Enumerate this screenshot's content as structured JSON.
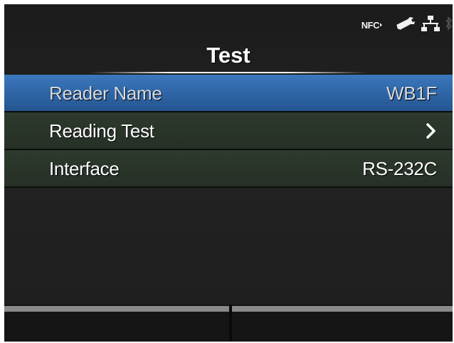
{
  "status": {
    "nfc_label": "NFC",
    "icons": [
      "nfc-icon",
      "wrench-icon",
      "network-icon",
      "bluetooth-icon"
    ]
  },
  "header": {
    "title": "Test"
  },
  "menu": {
    "items": [
      {
        "label": "Reader Name",
        "value": "WB1F",
        "selected": true
      },
      {
        "label": "Reading Test",
        "value": "",
        "chevron": true
      },
      {
        "label": "Interface",
        "value": "RS-232C"
      }
    ]
  },
  "softkeys": {
    "left_label": "",
    "right_label": ""
  },
  "colors": {
    "selected_row": "#2e64a4",
    "row_bg": "#2a352a",
    "background": "#1e1e1e"
  }
}
